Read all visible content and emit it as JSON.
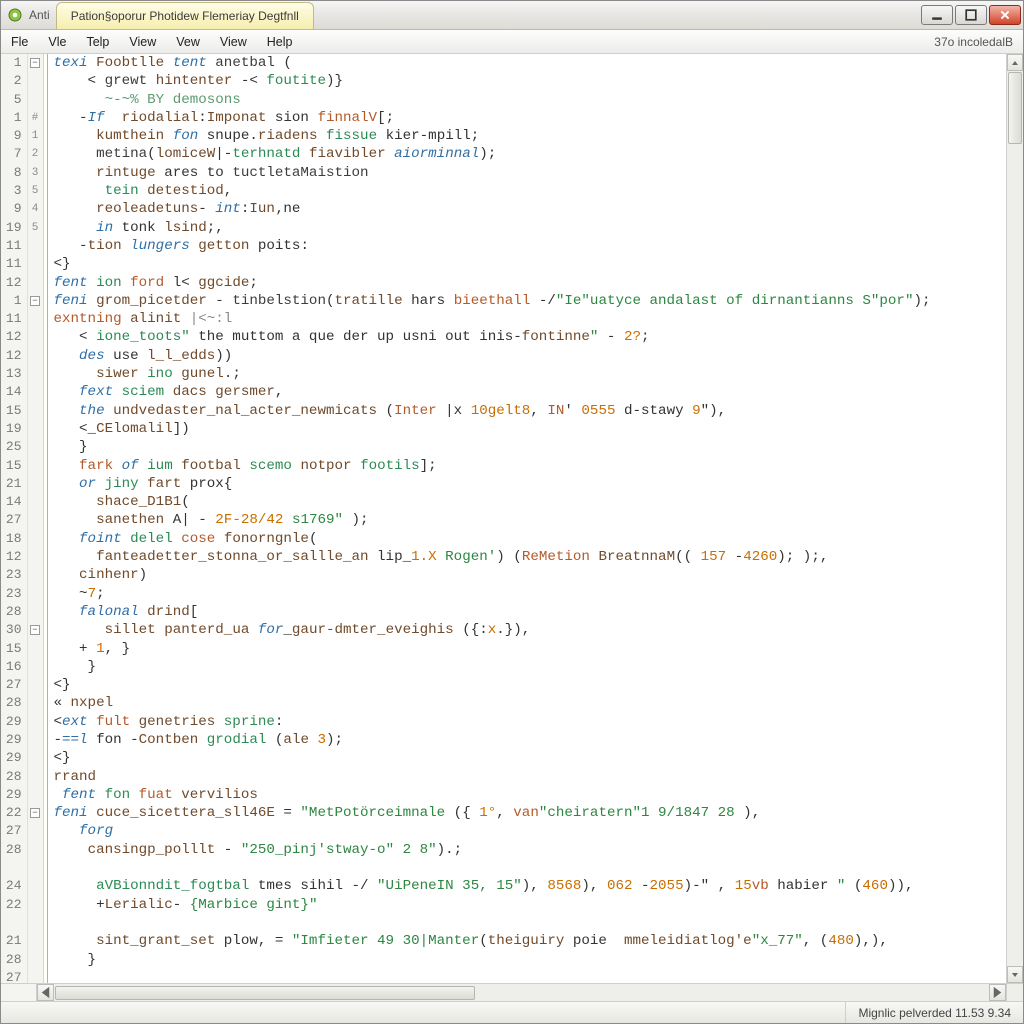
{
  "window": {
    "tab_title": "Pation§oporur Photidew Flemeriay Degtfnll"
  },
  "menubar": {
    "items": [
      "Fle",
      "Vle",
      "Telp",
      "View",
      "Vew",
      "View",
      "Help"
    ],
    "right_label": "37o incoledalB"
  },
  "statusbar": {
    "right": "Mignlic pelverded 11.53 9.34"
  },
  "gutter": [
    "1",
    "2",
    "5",
    "1",
    "9",
    "7",
    "8",
    "3",
    "9",
    "19",
    "11",
    "11",
    "12",
    "1",
    "11",
    "12",
    "12",
    "13",
    "14",
    "15",
    "19",
    "25",
    "15",
    "21",
    "14",
    "27",
    "18",
    "12",
    "23",
    "23",
    "28",
    "30",
    "15",
    "16",
    "27",
    "28",
    "29",
    "29",
    "29",
    "28",
    "29",
    "22",
    "27",
    "28",
    "",
    "24",
    "22",
    "",
    "21",
    "28",
    "27"
  ],
  "folds": [
    "⊟",
    "",
    "",
    "#",
    "1",
    "2",
    "3",
    "5",
    "4",
    "5",
    "",
    "",
    "",
    "⊟",
    "",
    "",
    "",
    "",
    "",
    "",
    "",
    "",
    "",
    "",
    "",
    "",
    "",
    "",
    "",
    "",
    "",
    "⊟",
    "",
    "",
    "",
    "",
    "",
    "",
    "",
    "",
    "",
    "⊟",
    "",
    "",
    "",
    "",
    "",
    "",
    "",
    "",
    ""
  ],
  "code": [
    [
      [
        "kw",
        "texi"
      ],
      [
        "pun",
        " "
      ],
      [
        "id",
        "Foobtlle"
      ],
      [
        "pun",
        " "
      ],
      [
        "kw",
        "tent"
      ],
      [
        "pun",
        " "
      ],
      [
        "fn",
        "anetbal"
      ],
      [
        "pun",
        " ("
      ]
    ],
    [
      [
        "pun",
        "    < "
      ],
      [
        "fn",
        "grewt"
      ],
      [
        "pun",
        " "
      ],
      [
        "id",
        "hintenter"
      ],
      [
        "pun",
        " -< "
      ],
      [
        "kw2",
        "foutite"
      ],
      [
        "pun",
        ")}"
      ]
    ],
    [
      [
        "cmt",
        "      ~-~% BY demosons"
      ]
    ],
    [
      [
        "pun",
        "   -"
      ],
      [
        "kw",
        "If"
      ],
      [
        "pun",
        "  "
      ],
      [
        "id",
        "riodalial"
      ],
      [
        "pun",
        ":"
      ],
      [
        "id",
        "Imponat"
      ],
      [
        "pun",
        " sion "
      ],
      [
        "acc",
        "finnalV"
      ],
      [
        "pun",
        "[;"
      ]
    ],
    [
      [
        "pun",
        "     "
      ],
      [
        "id",
        "kumthein"
      ],
      [
        "pun",
        " "
      ],
      [
        "kw",
        "fon"
      ],
      [
        "pun",
        " snupe."
      ],
      [
        "id",
        "riadens"
      ],
      [
        "pun",
        " "
      ],
      [
        "kw2",
        "fissue"
      ],
      [
        "pun",
        " kier-mpill;"
      ]
    ],
    [
      [
        "pun",
        "     "
      ],
      [
        "fn",
        "metina"
      ],
      [
        "pun",
        "("
      ],
      [
        "id",
        "lomiceW"
      ],
      [
        "pun",
        "|-"
      ],
      [
        "kw2",
        "terhnatd"
      ],
      [
        "pun",
        " "
      ],
      [
        "id",
        "fiavibler"
      ],
      [
        "pun",
        " "
      ],
      [
        "kw",
        "aiorminnal"
      ],
      [
        "pun",
        ");"
      ]
    ],
    [
      [
        "pun",
        "     "
      ],
      [
        "id",
        "rintuge"
      ],
      [
        "pun",
        " ares to "
      ],
      [
        "fn",
        "tuctletaMaistion"
      ]
    ],
    [
      [
        "pun",
        "      "
      ],
      [
        "kw2",
        "tein"
      ],
      [
        "pun",
        " "
      ],
      [
        "id",
        "detestiod"
      ],
      [
        "pun",
        ","
      ]
    ],
    [
      [
        "pun",
        "     "
      ],
      [
        "id",
        "reoleadetuns"
      ],
      [
        "pun",
        "- "
      ],
      [
        "kw",
        "int"
      ],
      [
        "pun",
        ":"
      ],
      [
        "id",
        "Iun"
      ],
      [
        "pun",
        "‚ne"
      ]
    ],
    [
      [
        "pun",
        "     "
      ],
      [
        "kw",
        "in"
      ],
      [
        "pun",
        " tonk "
      ],
      [
        "id",
        "lsind"
      ],
      [
        "pun",
        ";,"
      ]
    ],
    [
      [
        "pun",
        "   -"
      ],
      [
        "id",
        "tion"
      ],
      [
        "pun",
        " "
      ],
      [
        "kw",
        "lungers"
      ],
      [
        "pun",
        " "
      ],
      [
        "id",
        "getton"
      ],
      [
        "pun",
        " poits:"
      ]
    ],
    [
      [
        "pun",
        "<}"
      ]
    ],
    [
      [
        "kw",
        "fent"
      ],
      [
        "pun",
        " "
      ],
      [
        "kw2",
        "ion"
      ],
      [
        "pun",
        " "
      ],
      [
        "acc",
        "ford"
      ],
      [
        "pun",
        " l< "
      ],
      [
        "id",
        "ggcide"
      ],
      [
        "pun",
        ";"
      ]
    ],
    [
      [
        "kw",
        "feni"
      ],
      [
        "pun",
        " "
      ],
      [
        "id",
        "grom_picetder"
      ],
      [
        "pun",
        " - "
      ],
      [
        "fn",
        "tinbelstion"
      ],
      [
        "pun",
        "("
      ],
      [
        "id",
        "tratille"
      ],
      [
        "pun",
        " hars "
      ],
      [
        "acc",
        "bieethall"
      ],
      [
        "pun",
        " -/"
      ],
      [
        "str",
        "\"Ie\"uatyce andalast of dirnantianns S\"por\""
      ],
      [
        "pun",
        ");"
      ]
    ],
    [
      [
        "acc",
        "exntning"
      ],
      [
        "pun",
        " "
      ],
      [
        "id",
        "alinit"
      ],
      [
        "pun",
        " "
      ],
      [
        "dim",
        "|<~:l"
      ]
    ],
    [
      [
        "pun",
        "   < "
      ],
      [
        "kw2",
        "ione_toots\""
      ],
      [
        "pun",
        " the muttom a que der up usni out inis-"
      ],
      [
        "id",
        "fontinne"
      ],
      [
        "str",
        "\""
      ],
      [
        "pun",
        " - "
      ],
      [
        "num",
        "2?"
      ],
      [
        "pun",
        ";"
      ]
    ],
    [
      [
        "pun",
        "   "
      ],
      [
        "kw",
        "des"
      ],
      [
        "pun",
        " use "
      ],
      [
        "id",
        "l_l_edds"
      ],
      [
        "pun",
        "))"
      ]
    ],
    [
      [
        "pun",
        "     "
      ],
      [
        "id",
        "siwer"
      ],
      [
        "pun",
        " "
      ],
      [
        "kw2",
        "ino"
      ],
      [
        "pun",
        " "
      ],
      [
        "id",
        "gunel"
      ],
      [
        "pun",
        ".;"
      ]
    ],
    [
      [
        "pun",
        "   "
      ],
      [
        "kw",
        "fext"
      ],
      [
        "pun",
        " "
      ],
      [
        "kw2",
        "sciem"
      ],
      [
        "pun",
        " "
      ],
      [
        "id",
        "dacs"
      ],
      [
        "pun",
        " "
      ],
      [
        "id",
        "gersmer"
      ],
      [
        "pun",
        ","
      ]
    ],
    [
      [
        "pun",
        "   "
      ],
      [
        "kw",
        "the"
      ],
      [
        "pun",
        " "
      ],
      [
        "id",
        "undvedaster_nal_acter_newmicats"
      ],
      [
        "pun",
        " ("
      ],
      [
        "acc",
        "Inter"
      ],
      [
        "pun",
        " |x "
      ],
      [
        "num",
        "10gelt8"
      ],
      [
        "pun",
        ", "
      ],
      [
        "acc",
        "IN"
      ],
      [
        "pun",
        "' "
      ],
      [
        "num",
        "0555"
      ],
      [
        "pun",
        " d-stawy "
      ],
      [
        "num",
        "9"
      ],
      [
        "pun",
        "\"),"
      ]
    ],
    [
      [
        "pun",
        "   <_"
      ],
      [
        "id",
        "CElomalil"
      ],
      [
        "pun",
        "])"
      ]
    ],
    [
      [
        "pun",
        "   }"
      ]
    ],
    [
      [
        "pun",
        "   "
      ],
      [
        "acc",
        "fark"
      ],
      [
        "pun",
        " "
      ],
      [
        "kw",
        "of"
      ],
      [
        "pun",
        " "
      ],
      [
        "kw2",
        "ium"
      ],
      [
        "pun",
        " "
      ],
      [
        "id",
        "footbal"
      ],
      [
        "pun",
        " "
      ],
      [
        "kw2",
        "scemo"
      ],
      [
        "pun",
        " "
      ],
      [
        "id",
        "notpor"
      ],
      [
        "pun",
        " "
      ],
      [
        "kw2",
        "footils"
      ],
      [
        "pun",
        "];"
      ]
    ],
    [
      [
        "pun",
        "   "
      ],
      [
        "kw",
        "or"
      ],
      [
        "pun",
        " "
      ],
      [
        "kw2",
        "jiny"
      ],
      [
        "pun",
        " "
      ],
      [
        "id",
        "fart"
      ],
      [
        "pun",
        " prox{"
      ]
    ],
    [
      [
        "pun",
        "     "
      ],
      [
        "id",
        "shace_D1B1"
      ],
      [
        "pun",
        "("
      ]
    ],
    [
      [
        "pun",
        "     "
      ],
      [
        "id",
        "sanethen"
      ],
      [
        "pun",
        " A| - "
      ],
      [
        "num",
        "2F-28/42"
      ],
      [
        "pun",
        " "
      ],
      [
        "str",
        "s1769\""
      ],
      [
        "pun",
        " );"
      ]
    ],
    [
      [
        "pun",
        "   "
      ],
      [
        "kw",
        "foint"
      ],
      [
        "pun",
        " "
      ],
      [
        "kw2",
        "delel"
      ],
      [
        "pun",
        " "
      ],
      [
        "acc",
        "cose"
      ],
      [
        "pun",
        " "
      ],
      [
        "id",
        "fonorngnle"
      ],
      [
        "pun",
        "("
      ]
    ],
    [
      [
        "pun",
        "     "
      ],
      [
        "id",
        "fanteadetter_stonna_or_sallle_an"
      ],
      [
        "pun",
        " lip_"
      ],
      [
        "num",
        "1.X"
      ],
      [
        "pun",
        " "
      ],
      [
        "str",
        "Rogen'"
      ],
      [
        "pun",
        ") ("
      ],
      [
        "acc",
        "ReMetion"
      ],
      [
        "pun",
        " "
      ],
      [
        "id",
        "BreatnnaM"
      ],
      [
        "pun",
        "(( "
      ],
      [
        "num",
        "157"
      ],
      [
        "pun",
        " -"
      ],
      [
        "num",
        "4260"
      ],
      [
        "pun",
        "); );,"
      ]
    ],
    [
      [
        "pun",
        "   "
      ],
      [
        "id",
        "cinhenr"
      ],
      [
        "pun",
        ")"
      ]
    ],
    [
      [
        "pun",
        "   ~"
      ],
      [
        "num",
        "7"
      ],
      [
        "pun",
        ";"
      ]
    ],
    [
      [
        "pun",
        "   "
      ],
      [
        "kw",
        "falonal"
      ],
      [
        "pun",
        " "
      ],
      [
        "id",
        "drind"
      ],
      [
        "pun",
        "["
      ]
    ],
    [
      [
        "pun",
        "      "
      ],
      [
        "id",
        "sillet"
      ],
      [
        "pun",
        " "
      ],
      [
        "id",
        "panterd_ua"
      ],
      [
        "pun",
        " "
      ],
      [
        "kw",
        "for"
      ],
      [
        "pun",
        "_"
      ],
      [
        "id",
        "gaur-dmter_eveighis"
      ],
      [
        "pun",
        " ({:"
      ],
      [
        "num",
        "x"
      ],
      [
        "pun",
        ".}),"
      ]
    ],
    [
      [
        "pun",
        "   + "
      ],
      [
        "num",
        "1"
      ],
      [
        "pun",
        ", }"
      ]
    ],
    [
      [
        "pun",
        "    }"
      ]
    ],
    [
      [
        "pun",
        "<}"
      ]
    ],
    [
      [
        "pun",
        "« "
      ],
      [
        "id",
        "nxpel"
      ]
    ],
    [
      [
        "pun",
        "<"
      ],
      [
        "kw",
        "ext"
      ],
      [
        "pun",
        " "
      ],
      [
        "acc",
        "fult"
      ],
      [
        "pun",
        " "
      ],
      [
        "id",
        "genetries"
      ],
      [
        "pun",
        " "
      ],
      [
        "kw2",
        "sprine"
      ],
      [
        "pun",
        ":"
      ]
    ],
    [
      [
        "pun",
        "-"
      ],
      [
        "kw",
        "==l"
      ],
      [
        "pun",
        " fon -"
      ],
      [
        "id",
        "Contben"
      ],
      [
        "pun",
        " "
      ],
      [
        "kw2",
        "grodial"
      ],
      [
        "pun",
        " ("
      ],
      [
        "id",
        "ale"
      ],
      [
        "pun",
        " "
      ],
      [
        "num",
        "3"
      ],
      [
        "pun",
        ");"
      ]
    ],
    [
      [
        "pun",
        "<}"
      ]
    ],
    [
      [
        "id",
        "rrand"
      ]
    ],
    [
      [
        "pun",
        " "
      ],
      [
        "kw",
        "fent"
      ],
      [
        "pun",
        " "
      ],
      [
        "kw2",
        "fon"
      ],
      [
        "pun",
        " "
      ],
      [
        "acc",
        "fuat"
      ],
      [
        "pun",
        " "
      ],
      [
        "id",
        "vervilios"
      ]
    ],
    [
      [
        "kw",
        "feni"
      ],
      [
        "pun",
        " "
      ],
      [
        "id",
        "cuce_sicettera_sll46E"
      ],
      [
        "pun",
        " = "
      ],
      [
        "str",
        "\"MetPotörceimnale"
      ],
      [
        "pun",
        " ({ "
      ],
      [
        "num",
        "1°"
      ],
      [
        "pun",
        ", "
      ],
      [
        "acc",
        "van"
      ],
      [
        "str",
        "\"cheiratern\"1 9/1847 28"
      ],
      [
        "pun",
        " ),"
      ]
    ],
    [
      [
        "pun",
        "   "
      ],
      [
        "kw",
        "forg"
      ]
    ],
    [
      [
        "pun",
        "    "
      ],
      [
        "id",
        "cansingp_polllt"
      ],
      [
        "pun",
        " - "
      ],
      [
        "str",
        "\"250_pinj'stway-o\" 2 8\""
      ],
      [
        "pun",
        ").;"
      ]
    ],
    [
      [
        "pun",
        " "
      ]
    ],
    [
      [
        "pun",
        "     "
      ],
      [
        "kw2",
        "aVBionndit_fogtbal"
      ],
      [
        "pun",
        " tmes sihil -/ "
      ],
      [
        "str",
        "\"UiPeneIN 35, 15\""
      ],
      [
        "pun",
        "), "
      ],
      [
        "num",
        "8568"
      ],
      [
        "pun",
        "), "
      ],
      [
        "num",
        "062"
      ],
      [
        "pun",
        " -"
      ],
      [
        "num",
        "2055"
      ],
      [
        "pun",
        ")-\" , "
      ],
      [
        "num",
        "15"
      ],
      [
        "acc",
        "vb"
      ],
      [
        "pun",
        " habier "
      ],
      [
        "str",
        "\""
      ],
      [
        "pun",
        " ("
      ],
      [
        "num",
        "460"
      ],
      [
        "pun",
        ")),"
      ]
    ],
    [
      [
        "pun",
        "     +"
      ],
      [
        "id",
        "Lerialic"
      ],
      [
        "pun",
        "- "
      ],
      [
        "str",
        "{Marbice gint}\""
      ]
    ],
    [
      [
        "pun",
        " "
      ]
    ],
    [
      [
        "pun",
        "     "
      ],
      [
        "id",
        "sint_grant_set"
      ],
      [
        "pun",
        " plow, = "
      ],
      [
        "str",
        "\"Imfieter 49 30|Manter"
      ],
      [
        "pun",
        "("
      ],
      [
        "id",
        "theiguiry"
      ],
      [
        "pun",
        " poie  "
      ],
      [
        "id",
        "mmeleidiatlog'e"
      ],
      [
        "str",
        "\"x_77\""
      ],
      [
        "pun",
        ", ("
      ],
      [
        "num",
        "480"
      ],
      [
        "pun",
        "),),"
      ]
    ],
    [
      [
        "pun",
        "    }"
      ]
    ],
    [
      [
        "pun",
        " "
      ]
    ]
  ]
}
